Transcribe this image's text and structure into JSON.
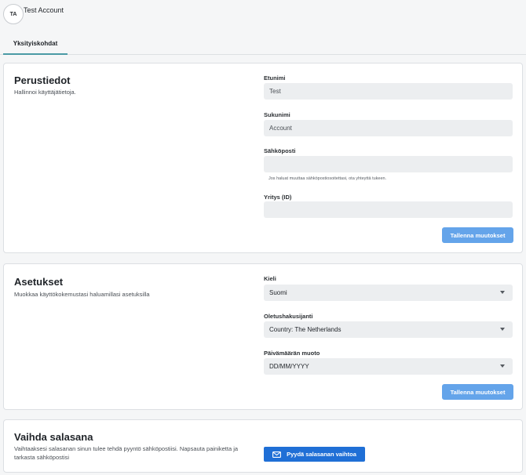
{
  "header": {
    "avatar_initials": "TA",
    "account_name": "Test Account",
    "tab_label": "Yksityiskohdat"
  },
  "basic_info": {
    "title": "Perustiedot",
    "subtitle": "Hallinnoi käyttäjätietoja.",
    "first_name_label": "Etunimi",
    "first_name_value": "Test",
    "last_name_label": "Sukunimi",
    "last_name_value": "Account",
    "email_label": "Sähköposti",
    "email_value": "",
    "email_hint": "Jos haluat muuttaa sähköpostiosoitettasi, ota yhteyttä tukeen.",
    "company_label": "Yritys (ID)",
    "company_value": "",
    "save_label": "Tallenna muutokset"
  },
  "settings": {
    "title": "Asetukset",
    "subtitle": "Muokkaa käyttökokemustasi haluamillasi asetuksilla",
    "language_label": "Kieli",
    "language_value": "Suomi",
    "search_engine_label": "Oletushakusijanti",
    "search_engine_value": "Country: The Netherlands",
    "date_format_label": "Päivämäärän muoto",
    "date_format_value": "DD/MM/YYYY",
    "save_label": "Tallenna muutokset"
  },
  "password": {
    "title": "Vaihda salasana",
    "subtitle": "Vaihtaaksesi salasanan sinun tulee tehdä pyyntö sähköpostiisi. Napsauta painiketta ja tarkasta sähköpostisi",
    "button_label": "Pyydä salasanan vaihtoa"
  },
  "colors": {
    "accent": "#4a9aa5",
    "save_button": "#64a4ea",
    "primary_button": "#1f6fd6"
  },
  "icons": {
    "caret": "chevron-down-icon",
    "mail": "mail-icon"
  }
}
